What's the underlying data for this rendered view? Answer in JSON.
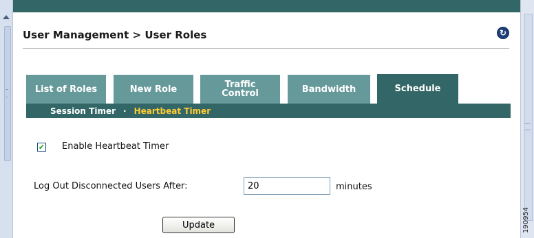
{
  "header": {
    "title": "User Management > User Roles",
    "refresh_icon": "refresh-icon"
  },
  "tabs": [
    {
      "label": "List of Roles",
      "active": false
    },
    {
      "label": "New Role",
      "active": false
    },
    {
      "label": "Traffic\nControl",
      "active": false
    },
    {
      "label": "Bandwidth",
      "active": false
    },
    {
      "label": "Schedule",
      "active": true
    }
  ],
  "subnav": {
    "items": [
      "Session Timer",
      "Heartbeat Timer"
    ],
    "separator": "·",
    "active": "Heartbeat Timer"
  },
  "form": {
    "enable_checked": true,
    "enable_label": "Enable Heartbeat Timer",
    "logout_label": "Log Out Disconnected Users After:",
    "logout_value": "20",
    "unit": "minutes",
    "update_label": "Update"
  },
  "figure_id": "190954",
  "colors": {
    "tab_inactive": "#66999a",
    "tab_active": "#336666",
    "active_subtab": "#ffcc33"
  }
}
